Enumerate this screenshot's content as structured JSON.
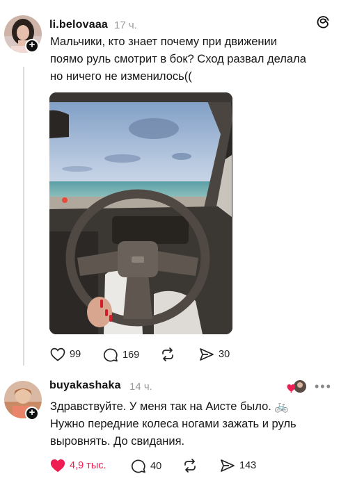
{
  "post": {
    "username": "li.belovaaa",
    "time": "17 ч.",
    "text_lines": [
      "Мальчики, кто знает почему при движении",
      "поямо руль смотрит в бок? Сход развал делала",
      "но ничего не изменилось(("
    ],
    "actions": {
      "likes": "99",
      "comments": "169",
      "reposts": "",
      "shares": "30"
    }
  },
  "reply": {
    "username": "buyakashaka",
    "time": "14 ч.",
    "text_lines": [
      "Здравствуйте. У меня так на Аисте было. 🚲",
      "Нужно передние колеса ногами зажать и руль",
      "выровнять. До свидания."
    ],
    "actions": {
      "likes": "4,9 тыс.",
      "comments": "40",
      "reposts": "",
      "shares": "143"
    },
    "more": "•••"
  },
  "colors": {
    "like_active": "#ee1d52",
    "muted": "#9a9a9a",
    "thread_line": "#dcdcdc"
  },
  "icons": [
    "threads-logo-icon",
    "heart-icon",
    "comment-icon",
    "repost-icon",
    "share-icon",
    "plus-icon",
    "more-icon"
  ]
}
